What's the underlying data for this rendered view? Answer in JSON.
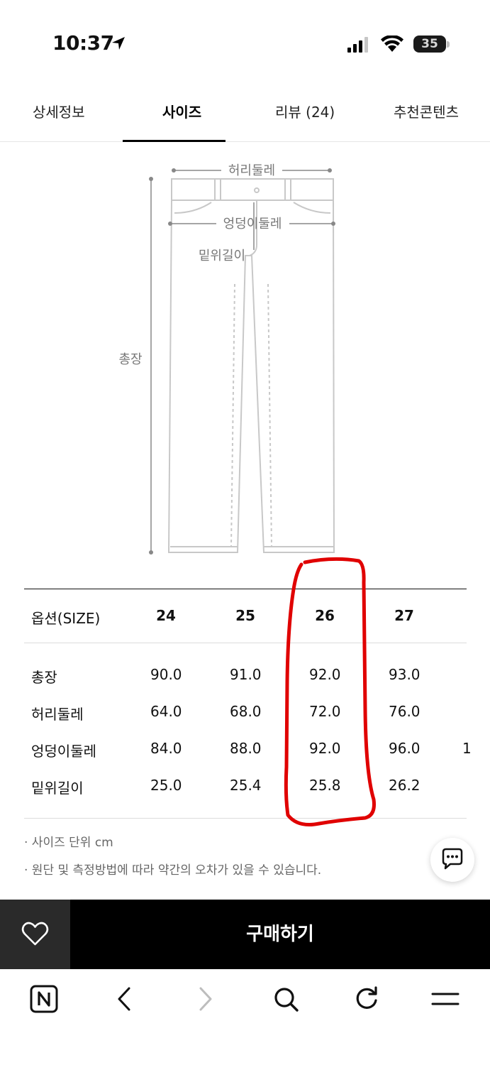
{
  "status": {
    "time": "10:37",
    "battery": "35"
  },
  "tabs": [
    {
      "label": "상세정보",
      "active": false
    },
    {
      "label": "사이즈",
      "active": true
    },
    {
      "label": "리뷰 (24)",
      "active": false
    },
    {
      "label": "추천콘텐츠",
      "active": false
    }
  ],
  "diagram": {
    "waist": "허리둘레",
    "hip": "엉덩이둘레",
    "rise": "밑위길이",
    "length": "총장"
  },
  "size_table": {
    "header": {
      "label": "옵션(SIZE)",
      "sizes": [
        "24",
        "25",
        "26",
        "27"
      ]
    },
    "rows": [
      {
        "label": "총장",
        "values": [
          "90.0",
          "91.0",
          "92.0",
          "93.0",
          ""
        ]
      },
      {
        "label": "허리둘레",
        "values": [
          "64.0",
          "68.0",
          "72.0",
          "76.0",
          ""
        ]
      },
      {
        "label": "엉덩이둘레",
        "values": [
          "84.0",
          "88.0",
          "92.0",
          "96.0",
          "1"
        ]
      },
      {
        "label": "밑위길이",
        "values": [
          "25.0",
          "25.4",
          "25.8",
          "26.2",
          ""
        ]
      }
    ]
  },
  "notes": [
    "· 사이즈 단위 cm",
    "· 원단 및 측정방법에 따라 약간의 오차가 있을 수 있습니다."
  ],
  "buy_bar": {
    "buy_label": "구매하기"
  },
  "icons": {
    "wish": "heart-icon",
    "chat": "chat-bubble-icon",
    "browser": [
      "naver-home-icon",
      "back-icon",
      "forward-icon",
      "search-icon",
      "refresh-icon",
      "menu-icon"
    ]
  },
  "colors": {
    "highlight": "#e00000",
    "buy_bar": "#000000",
    "wish_btn": "#2a2a2a"
  }
}
